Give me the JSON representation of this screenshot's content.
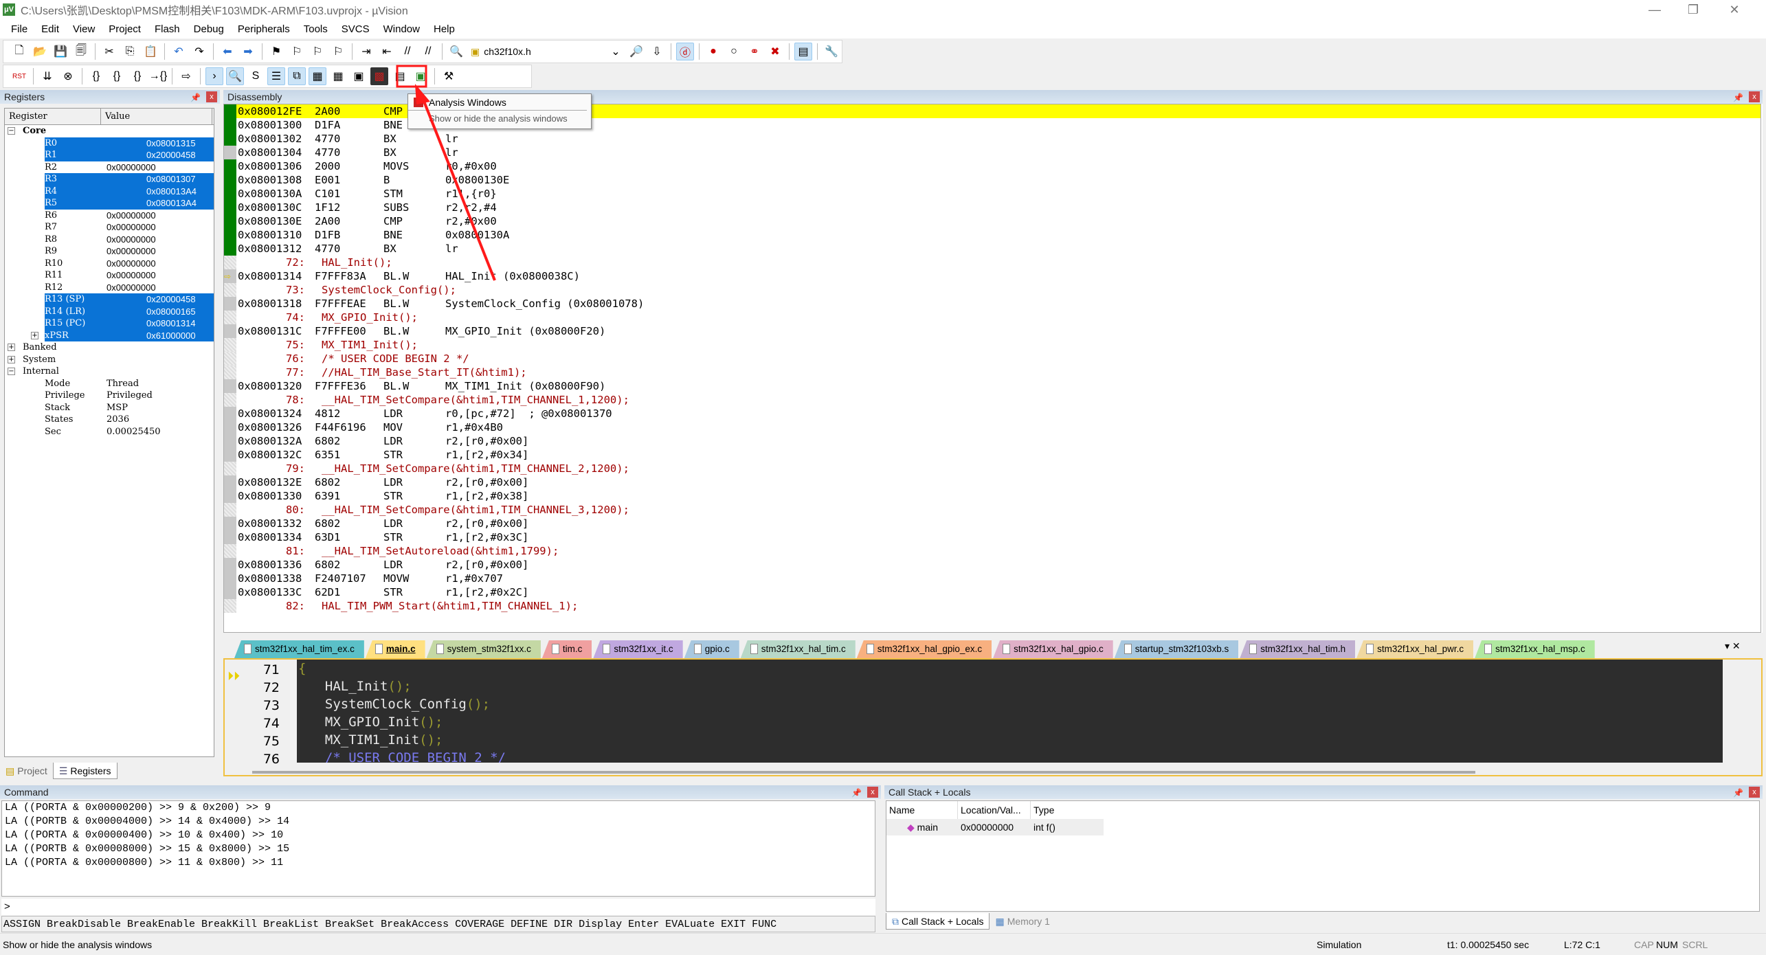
{
  "window": {
    "title": "C:\\Users\\张凯\\Desktop\\PMSM控制相关\\F103\\MDK-ARM\\F103.uvprojx - µVision",
    "minimize": "—",
    "restore": "❐",
    "close": "✕"
  },
  "menu": [
    "File",
    "Edit",
    "View",
    "Project",
    "Flash",
    "Debug",
    "Peripherals",
    "Tools",
    "SVCS",
    "Window",
    "Help"
  ],
  "toolbar1": {
    "file_combo": "ch32f10x.h",
    "icons_left": [
      "new-file-icon",
      "open-folder-icon",
      "save-icon",
      "save-all-icon",
      "sep",
      "cut-icon",
      "copy-icon",
      "paste-icon",
      "sep",
      "undo-icon",
      "redo-icon",
      "sep",
      "navigate-back-icon",
      "navigate-forward-icon",
      "sep",
      "bookmark-icon",
      "prev-bookmark-icon",
      "next-bookmark-icon",
      "clear-bookmarks-icon",
      "sep",
      "indent-icon",
      "unindent-icon",
      "comment-icon",
      "uncomment-icon",
      "sep",
      "find-in-files-icon"
    ],
    "icons_right": [
      "dropdown-icon",
      "find-icon",
      "incremental-find-icon",
      "sep",
      "debug-session-icon",
      "sep",
      "breakpoint-icon",
      "disable-breakpoint-icon",
      "disable-all-breakpoints-icon",
      "kill-all-breakpoints-icon",
      "sep",
      "window-layout-icon",
      "sep",
      "configure-icon"
    ]
  },
  "toolbar2": {
    "icons": [
      "reset-icon",
      "sep",
      "run-icon",
      "stop-icon",
      "sep",
      "step-into-icon",
      "step-over-icon",
      "step-out-icon",
      "run-to-cursor-icon",
      "sep",
      "show-next-statement-icon",
      "sep",
      "command-window-icon",
      "disassembly-window-icon",
      "symbols-window-icon",
      "registers-window-icon",
      "call-stack-window-icon",
      "watch-windows-icon",
      "memory-windows-icon",
      "serial-windows-icon",
      "analysis-windows-icon",
      "trace-windows-icon",
      "system-viewer-icon",
      "sep",
      "toolbox-icon"
    ]
  },
  "tooltip": {
    "title": "Analysis Windows",
    "text": "Show or hide the analysis windows"
  },
  "registers": {
    "title": "Registers",
    "col_register": "Register",
    "col_value": "Value",
    "groups": {
      "core": "Core",
      "banked": "Banked",
      "system": "System",
      "internal": "Internal"
    },
    "core": [
      {
        "name": "R0",
        "value": "0x08001315",
        "changed": true
      },
      {
        "name": "R1",
        "value": "0x20000458",
        "changed": true
      },
      {
        "name": "R2",
        "value": "0x00000000",
        "changed": false
      },
      {
        "name": "R3",
        "value": "0x08001307",
        "changed": true
      },
      {
        "name": "R4",
        "value": "0x080013A4",
        "changed": true
      },
      {
        "name": "R5",
        "value": "0x080013A4",
        "changed": true
      },
      {
        "name": "R6",
        "value": "0x00000000",
        "changed": false
      },
      {
        "name": "R7",
        "value": "0x00000000",
        "changed": false
      },
      {
        "name": "R8",
        "value": "0x00000000",
        "changed": false
      },
      {
        "name": "R9",
        "value": "0x00000000",
        "changed": false
      },
      {
        "name": "R10",
        "value": "0x00000000",
        "changed": false
      },
      {
        "name": "R11",
        "value": "0x00000000",
        "changed": false
      },
      {
        "name": "R12",
        "value": "0x00000000",
        "changed": false
      },
      {
        "name": "R13 (SP)",
        "value": "0x20000458",
        "changed": true
      },
      {
        "name": "R14 (LR)",
        "value": "0x08000165",
        "changed": true
      },
      {
        "name": "R15 (PC)",
        "value": "0x08001314",
        "changed": true
      },
      {
        "name": "xPSR",
        "value": "0x61000000",
        "changed": true
      }
    ],
    "internal": [
      {
        "name": "Mode",
        "value": "Thread"
      },
      {
        "name": "Privilege",
        "value": "Privileged"
      },
      {
        "name": "Stack",
        "value": "MSP"
      },
      {
        "name": "States",
        "value": "2036"
      },
      {
        "name": "Sec",
        "value": "0.00025450"
      }
    ],
    "tabs": [
      "Project",
      "Registers"
    ]
  },
  "disassembly": {
    "title": "Disassembly",
    "rows": [
      {
        "t": "asm",
        "m": "g",
        "addr": "0x080012FE",
        "hex": "2A00",
        "mn": "CMP",
        "op": "",
        "cur": true
      },
      {
        "t": "asm",
        "m": "g",
        "addr": "0x08001300",
        "hex": "D1FA",
        "mn": "BNE",
        "op": ""
      },
      {
        "t": "asm",
        "m": "g",
        "addr": "0x08001302",
        "hex": "4770",
        "mn": "BX",
        "op": "lr"
      },
      {
        "t": "asm",
        "m": "k",
        "addr": "0x08001304",
        "hex": "4770",
        "mn": "BX",
        "op": "lr"
      },
      {
        "t": "asm",
        "m": "g",
        "addr": "0x08001306",
        "hex": "2000",
        "mn": "MOVS",
        "op": "r0,#0x00"
      },
      {
        "t": "asm",
        "m": "g",
        "addr": "0x08001308",
        "hex": "E001",
        "mn": "B",
        "op": "0x0800130E"
      },
      {
        "t": "asm",
        "m": "g",
        "addr": "0x0800130A",
        "hex": "C101",
        "mn": "STM",
        "op": "r1!,{r0}"
      },
      {
        "t": "asm",
        "m": "g",
        "addr": "0x0800130C",
        "hex": "1F12",
        "mn": "SUBS",
        "op": "r2,r2,#4"
      },
      {
        "t": "asm",
        "m": "g",
        "addr": "0x0800130E",
        "hex": "2A00",
        "mn": "CMP",
        "op": "r2,#0x00"
      },
      {
        "t": "asm",
        "m": "g",
        "addr": "0x08001310",
        "hex": "D1FB",
        "mn": "BNE",
        "op": "0x0800130A"
      },
      {
        "t": "asm",
        "m": "g",
        "addr": "0x08001312",
        "hex": "4770",
        "mn": "BX",
        "op": "lr"
      },
      {
        "t": "src",
        "ln": "72:",
        "code": "HAL_Init();"
      },
      {
        "t": "asm",
        "m": "k",
        "addr": "0x08001314",
        "hex": "F7FFF83A",
        "mn": "BL.W",
        "op": "HAL_Init (0x0800038C)",
        "arrow": true
      },
      {
        "t": "src",
        "ln": "73:",
        "code": "SystemClock_Config();"
      },
      {
        "t": "asm",
        "m": "k",
        "addr": "0x08001318",
        "hex": "F7FFFEAE",
        "mn": "BL.W",
        "op": "SystemClock_Config (0x08001078)"
      },
      {
        "t": "src",
        "ln": "74:",
        "code": "MX_GPIO_Init();"
      },
      {
        "t": "asm",
        "m": "k",
        "addr": "0x0800131C",
        "hex": "F7FFFE00",
        "mn": "BL.W",
        "op": "MX_GPIO_Init (0x08000F20)"
      },
      {
        "t": "src",
        "ln": "75:",
        "code": "MX_TIM1_Init();"
      },
      {
        "t": "src",
        "ln": "76:",
        "code": "/* USER CODE BEGIN 2 */"
      },
      {
        "t": "src",
        "ln": "77:",
        "code": "//HAL_TIM_Base_Start_IT(&htim1);"
      },
      {
        "t": "asm",
        "m": "k",
        "addr": "0x08001320",
        "hex": "F7FFFE36",
        "mn": "BL.W",
        "op": "MX_TIM1_Init (0x08000F90)"
      },
      {
        "t": "src",
        "ln": "78:",
        "code": "__HAL_TIM_SetCompare(&htim1,TIM_CHANNEL_1,1200);"
      },
      {
        "t": "asm",
        "m": "k",
        "addr": "0x08001324",
        "hex": "4812",
        "mn": "LDR",
        "op": "r0,[pc,#72]  ; @0x08001370"
      },
      {
        "t": "asm",
        "m": "k",
        "addr": "0x08001326",
        "hex": "F44F6196",
        "mn": "MOV",
        "op": "r1,#0x4B0"
      },
      {
        "t": "asm",
        "m": "k",
        "addr": "0x0800132A",
        "hex": "6802",
        "mn": "LDR",
        "op": "r2,[r0,#0x00]"
      },
      {
        "t": "asm",
        "m": "k",
        "addr": "0x0800132C",
        "hex": "6351",
        "mn": "STR",
        "op": "r1,[r2,#0x34]"
      },
      {
        "t": "src",
        "ln": "79:",
        "code": "__HAL_TIM_SetCompare(&htim1,TIM_CHANNEL_2,1200);"
      },
      {
        "t": "asm",
        "m": "k",
        "addr": "0x0800132E",
        "hex": "6802",
        "mn": "LDR",
        "op": "r2,[r0,#0x00]"
      },
      {
        "t": "asm",
        "m": "k",
        "addr": "0x08001330",
        "hex": "6391",
        "mn": "STR",
        "op": "r1,[r2,#0x38]"
      },
      {
        "t": "src",
        "ln": "80:",
        "code": "__HAL_TIM_SetCompare(&htim1,TIM_CHANNEL_3,1200);"
      },
      {
        "t": "asm",
        "m": "k",
        "addr": "0x08001332",
        "hex": "6802",
        "mn": "LDR",
        "op": "r2,[r0,#0x00]"
      },
      {
        "t": "asm",
        "m": "k",
        "addr": "0x08001334",
        "hex": "63D1",
        "mn": "STR",
        "op": "r1,[r2,#0x3C]"
      },
      {
        "t": "src",
        "ln": "81:",
        "code": "__HAL_TIM_SetAutoreload(&htim1,1799);"
      },
      {
        "t": "asm",
        "m": "k",
        "addr": "0x08001336",
        "hex": "6802",
        "mn": "LDR",
        "op": "r2,[r0,#0x00]"
      },
      {
        "t": "asm",
        "m": "k",
        "addr": "0x08001338",
        "hex": "F2407107",
        "mn": "MOVW",
        "op": "r1,#0x707"
      },
      {
        "t": "asm",
        "m": "k",
        "addr": "0x0800133C",
        "hex": "62D1",
        "mn": "STR",
        "op": "r1,[r2,#0x2C]"
      },
      {
        "t": "src",
        "ln": "82:",
        "code": "HAL_TIM_PWM_Start(&htim1,TIM_CHANNEL_1);"
      }
    ]
  },
  "file_tabs": [
    {
      "label": "stm32f1xx_hal_tim_ex.c",
      "color": "#5bc0c8"
    },
    {
      "label": "main.c",
      "color": "#ffe080",
      "active": true
    },
    {
      "label": "system_stm32f1xx.c",
      "color": "#c4d8a4"
    },
    {
      "label": "tim.c",
      "color": "#f0a0a0"
    },
    {
      "label": "stm32f1xx_it.c",
      "color": "#c0a8e0"
    },
    {
      "label": "gpio.c",
      "color": "#a8c8e0"
    },
    {
      "label": "stm32f1xx_hal_tim.c",
      "color": "#b8d8c8"
    },
    {
      "label": "stm32f1xx_hal_gpio_ex.c",
      "color": "#f8b080"
    },
    {
      "label": "stm32f1xx_hal_gpio.c",
      "color": "#e0b0c8"
    },
    {
      "label": "startup_stm32f103xb.s",
      "color": "#a8c8e0"
    },
    {
      "label": "stm32f1xx_hal_tim.h",
      "color": "#c0b0d0"
    },
    {
      "label": "stm32f1xx_hal_pwr.c",
      "color": "#f0d8a0"
    },
    {
      "label": "stm32f1xx_hal_msp.c",
      "color": "#b0e8a0"
    }
  ],
  "editor": {
    "lines": [
      {
        "n": "71",
        "code": "{",
        "paren": ""
      },
      {
        "n": "72",
        "code": "  HAL_Init",
        "paren": "();"
      },
      {
        "n": "73",
        "code": "  SystemClock_Config",
        "paren": "();"
      },
      {
        "n": "74",
        "code": "  MX_GPIO_Init",
        "paren": "();"
      },
      {
        "n": "75",
        "code": "  MX_TIM1_Init",
        "paren": "();"
      },
      {
        "n": "76",
        "code": "  /* USER CODE BEGIN 2 */",
        "paren": ""
      }
    ]
  },
  "command": {
    "title": "Command",
    "output": [
      "LA ((PORTA & 0x00000200) >> 9 & 0x200) >> 9",
      "LA ((PORTB & 0x00004000) >> 14 & 0x4000) >> 14",
      "LA ((PORTA & 0x00000400) >> 10 & 0x400) >> 10",
      "LA ((PORTB & 0x00008000) >> 15 & 0x8000) >> 15",
      "LA ((PORTA & 0x00000800) >> 11 & 0x800) >> 11"
    ],
    "prompt": ">",
    "help": "ASSIGN BreakDisable BreakEnable BreakKill BreakList BreakSet BreakAccess COVERAGE DEFINE DIR Display Enter EVALuate EXIT FUNC"
  },
  "callstack": {
    "title": "Call Stack + Locals",
    "cols": [
      "Name",
      "Location/Val...",
      "Type"
    ],
    "rows": [
      {
        "name": "main",
        "location": "0x00000000",
        "type": "int f()"
      }
    ],
    "tabs": [
      "Call Stack + Locals",
      "Memory 1"
    ]
  },
  "status": {
    "message": "Show or hide the analysis windows",
    "mode": "Simulation",
    "time": "t1: 0.00025450 sec",
    "pos": "L:72 C:1",
    "cap": "CAP",
    "num": "NUM",
    "scrl": "SCRL"
  }
}
